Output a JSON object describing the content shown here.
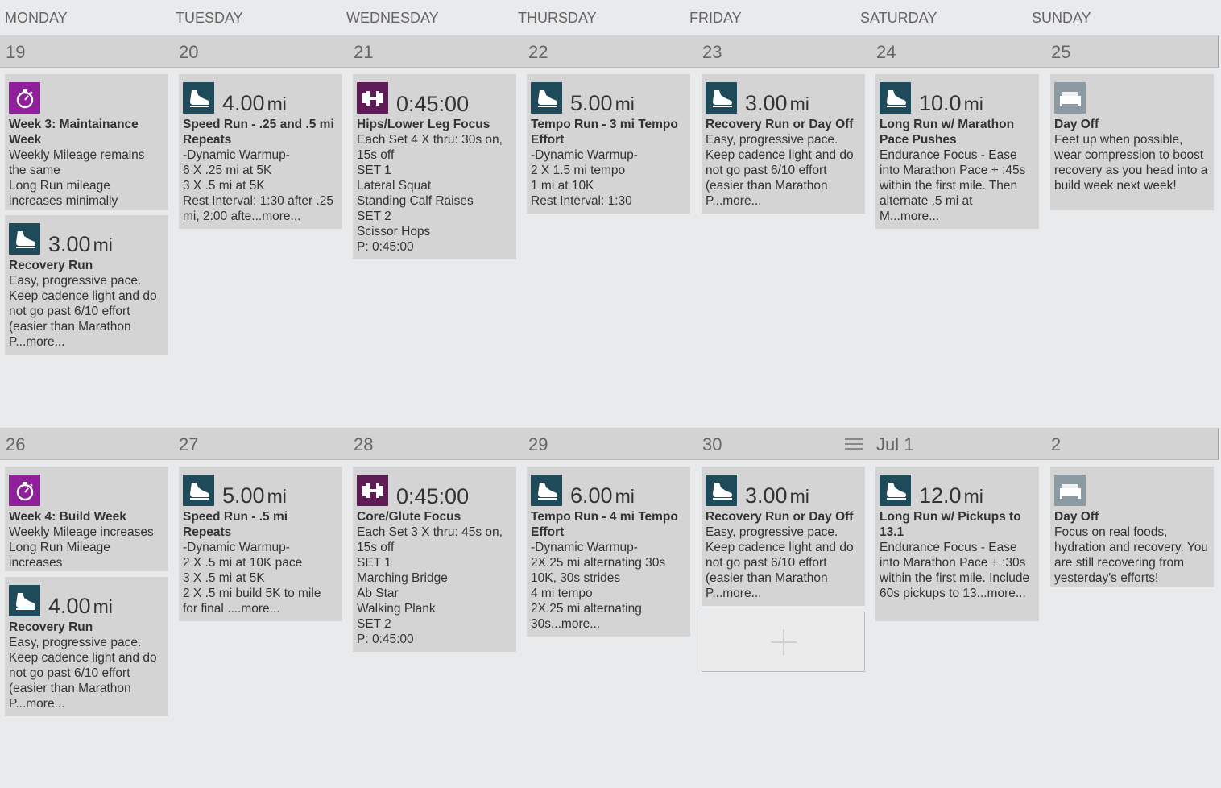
{
  "days": [
    "MONDAY",
    "TUESDAY",
    "WEDNESDAY",
    "THURSDAY",
    "FRIDAY",
    "SATURDAY",
    "SUNDAY"
  ],
  "weeks": [
    {
      "dates": [
        "19",
        "20",
        "21",
        "22",
        "23",
        "24",
        "25"
      ],
      "cards": [
        {
          "icon": "stopwatch-icon",
          "type": "timer",
          "title": "Week 3: Maintainance Week",
          "desc": "Weekly Mileage remains the same\nLong Run mileage increases minimally"
        },
        {
          "icon": "shoe-icon",
          "type": "run",
          "distance": "3.00",
          "unit": "mi",
          "title": "Recovery Run",
          "desc": "Easy, progressive pace. Keep cadence light and do not go past 6/10 effort (easier than Marathon P...more..."
        },
        {
          "icon": "shoe-icon",
          "type": "run",
          "distance": "4.00",
          "unit": "mi",
          "title": "Speed Run - .25 and .5 mi Repeats",
          "desc": "-Dynamic Warmup-\n6 X .25 mi at 5K\n3 X .5 mi at 5K\nRest Interval: 1:30 after .25 mi, 2:00 afte...more..."
        },
        {
          "icon": "dumbbell-icon",
          "type": "strength",
          "distance": "0:45:00",
          "unit": "",
          "title": "Hips/Lower Leg Focus",
          "desc": "Each Set 4 X thru: 30s on, 15s off\nSET 1\nLateral Squat\nStanding Calf Raises\nSET 2\nScissor Hops\nP: 0:45:00"
        },
        {
          "icon": "shoe-icon",
          "type": "run",
          "distance": "5.00",
          "unit": "mi",
          "title": "Tempo Run - 3 mi Tempo Effort",
          "desc": "-Dynamic Warmup-\n2 X 1.5 mi tempo\n1 mi at 10K\nRest Interval: 1:30"
        },
        {
          "icon": "shoe-icon",
          "type": "run",
          "distance": "3.00",
          "unit": "mi",
          "title": "Recovery Run or Day Off",
          "desc": "Easy, progressive pace. Keep cadence light and do not go past 6/10 effort (easier than Marathon P...more..."
        },
        {
          "icon": "shoe-icon",
          "type": "run",
          "distance": "10.0",
          "unit": "mi",
          "title": "Long Run w/ Marathon Pace Pushes",
          "desc": "Endurance Focus - Ease into Marathon Pace + :45s within the first mile. Then alternate .5 mi at M...more..."
        },
        {
          "icon": "bed-icon",
          "type": "rest",
          "title": "Day Off",
          "desc": "Feet up when possible, wear compression to boost recovery as you head into a build week next week!"
        }
      ]
    },
    {
      "dates": [
        "26",
        "27",
        "28",
        "29",
        "30",
        "Jul 1",
        "2"
      ],
      "cards": [
        {
          "icon": "stopwatch-icon",
          "type": "timer",
          "title": "Week 4: Build Week",
          "desc": "Weekly Mileage increases\nLong Run Mileage increases"
        },
        {
          "icon": "shoe-icon",
          "type": "run",
          "distance": "4.00",
          "unit": "mi",
          "title": "Recovery Run",
          "desc": "Easy, progressive pace. Keep cadence light and do not go past 6/10 effort (easier than Marathon P...more..."
        },
        {
          "icon": "shoe-icon",
          "type": "run",
          "distance": "5.00",
          "unit": "mi",
          "title": "Speed Run - .5 mi Repeats",
          "desc": "-Dynamic Warmup-\n2 X .5 mi at 10K pace\n3 X .5 mi at 5K\n2 X .5 mi build 5K to mile for final ....more..."
        },
        {
          "icon": "dumbbell-icon",
          "type": "strength",
          "distance": "0:45:00",
          "unit": "",
          "title": "Core/Glute Focus",
          "desc": "Each Set 3 X thru: 45s on, 15s off\nSET 1\nMarching Bridge\nAb Star\nWalking Plank\nSET 2\nP: 0:45:00"
        },
        {
          "icon": "shoe-icon",
          "type": "run",
          "distance": "6.00",
          "unit": "mi",
          "title": "Tempo Run - 4 mi Tempo Effort",
          "desc": "-Dynamic Warmup-\n2X.25 mi alternating 30s 10K, 30s strides\n4 mi tempo\n2X.25 mi alternating 30s...more..."
        },
        {
          "icon": "shoe-icon",
          "type": "run",
          "distance": "3.00",
          "unit": "mi",
          "title": "Recovery Run or Day Off",
          "desc": "Easy, progressive pace. Keep cadence light and do not go past 6/10 effort (easier than Marathon P...more..."
        },
        {
          "icon": "shoe-icon",
          "type": "run",
          "distance": "12.0",
          "unit": "mi",
          "title": "Long Run w/ Pickups to 13.1",
          "desc": "Endurance Focus - Ease into Marathon Pace + :30s within the first mile. Include 60s pickups to 13...more..."
        },
        {
          "icon": "bed-icon",
          "type": "rest",
          "title": "Day Off",
          "desc": "Focus on real foods, hydration and recovery. You are still recovering from yesterday's efforts!"
        }
      ]
    }
  ]
}
